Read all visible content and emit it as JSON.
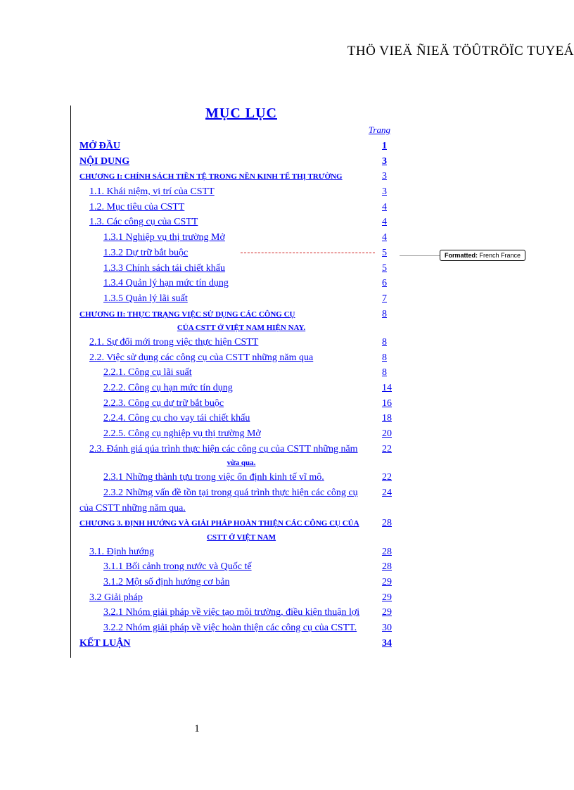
{
  "header": "THÖ VIEÄ ÑIEÄ TÖÛTRÖÏC TUYEÁ",
  "toc_title": "MỤC LỤC",
  "page_label": "Trang",
  "balloon": {
    "label": "Formatted:",
    "value": " French France"
  },
  "page_number": "1",
  "rows": [
    {
      "text": "MỞ ĐẦU",
      "page": "1",
      "cls": "bold"
    },
    {
      "text": "NỘI DUNG",
      "page": "3",
      "cls": "bold"
    },
    {
      "text": "CHƯƠNG I:    CHÍNH SÁCH TIỀN TỆ TRONG NỀN KINH TẾ THỊ TRƯỜNG",
      "page": "3",
      "cls": "small"
    },
    {
      "text": "  1.1. Khái niệm, vị trí của CSTT",
      "page": "3",
      "cls": "indent-1"
    },
    {
      "text": "  1.2. Mục tiêu của CSTT",
      "page": "4",
      "cls": "indent-1"
    },
    {
      "text": "  1.3. Các công cụ của CSTT",
      "page": "4",
      "cls": "indent-1"
    },
    {
      "text": "1.3.1 Nghiệp vụ thị trường Mở",
      "page": "4",
      "cls": "indent-2"
    },
    {
      "text": "1.3.2 Dự trữ bắt buộc",
      "page": "5",
      "cls": "indent-2 dashed-row",
      "dashed": true
    },
    {
      "text": "1.3.3 Chính sách tái chiết khấu",
      "page": "5",
      "cls": "indent-2"
    },
    {
      "text": "1.3.4 Quản lý hạn mức tín dụng",
      "page": "6",
      "cls": "indent-2"
    },
    {
      "text": "1.3.5 Quản lý lãi suất",
      "page": "7",
      "cls": "indent-2"
    },
    {
      "text": "CHƯƠNG II:   THỰC TRẠNG VIỆC SỬ DỤNG CÁC CÔNG CỤ",
      "page": "8",
      "cls": "small"
    },
    {
      "center": "CỦA CSTT Ở VIỆT NAM HIỆN NAY."
    },
    {
      "text": "  2.1. Sự đổi mới trong việc thực hiện CSTT",
      "page": "8",
      "cls": "indent-1"
    },
    {
      "text": "  2.2. Việc sử dụng các công cụ của CSTT những năm qua",
      "page": "8",
      "cls": "indent-1"
    },
    {
      "text": "2.2.1. Công cụ lãi suất",
      "page": "8",
      "cls": "indent-2"
    },
    {
      "text": "2.2.2. Công cụ hạn mức tín dụng",
      "page": "14",
      "cls": "indent-2"
    },
    {
      "text": "2.2.3. Công cụ dự trữ bắt buộc",
      "page": "16",
      "cls": "indent-2"
    },
    {
      "text": "2.2.4. Công cụ cho vay tái chiết khấu",
      "page": "18",
      "cls": "indent-2"
    },
    {
      "text": "2.2.5. Công cụ nghiệp vụ thị trường Mở",
      "page": "20",
      "cls": "indent-2"
    },
    {
      "text": "  2.3. Đánh giá qúa trình thực hiện các công cụ của CSTT  những năm",
      "page": "22",
      "cls": "indent-1 multiline"
    },
    {
      "center": "vừa qua."
    },
    {
      "text": "2.3.1 Những thành tựu trong việc ổn định kinh tế vĩ mô.",
      "page": "22",
      "cls": "indent-2"
    },
    {
      "text": "2.3.2 Những vấn đề tồn tại trong quá trình thực hiện các công cụ",
      "page": "24",
      "cls": "indent-2"
    },
    {
      "text": "của CSTT những năm qua.",
      "page": "",
      "cls": ""
    },
    {
      "text": "  CHƯƠNG 3. ĐỊNH HƯỚNG VÀ GIẢI PHÁP HOÀN THIỆN CÁC CÔNG CỤ CỦA",
      "page": "28",
      "cls": "small"
    },
    {
      "center": "CSTT Ở VIỆT NAM"
    },
    {
      "text": "  3.1. Định hướng",
      "page": "28",
      "cls": "indent-1"
    },
    {
      "text": "3.1.1 Bối cảnh trong nước và Quốc tế",
      "page": "28",
      "cls": "indent-2"
    },
    {
      "text": "3.1.2 Một số định hướng cơ bản",
      "page": "29",
      "cls": "indent-2"
    },
    {
      "text": "  3.2 Giải pháp",
      "page": "29",
      "cls": "indent-1"
    },
    {
      "text": "3.2.1 Nhóm giải pháp về việc tạo môi trường, điều kiện thuận lợi",
      "page": "29",
      "cls": "indent-2"
    },
    {
      "text": "3.2.2 Nhóm giải pháp về việc hoàn thiện các công cụ của CSTT.",
      "page": "30",
      "cls": "indent-2"
    },
    {
      "text": "KẾT LUẬN",
      "page": "34",
      "cls": "bold"
    }
  ]
}
